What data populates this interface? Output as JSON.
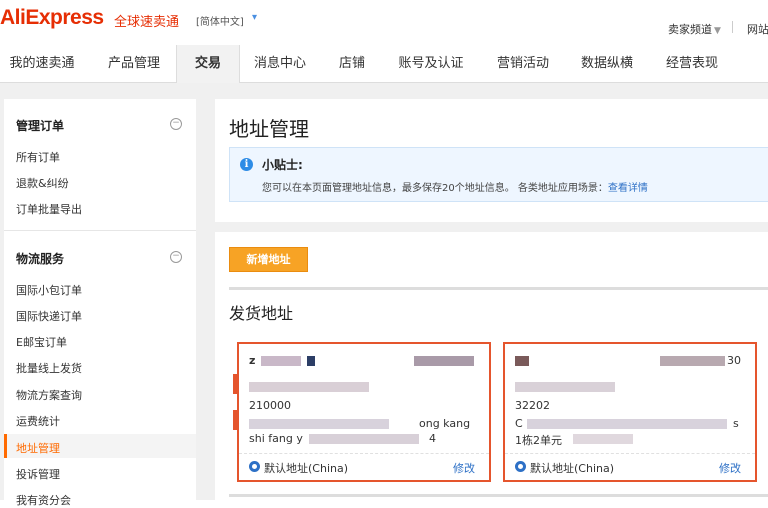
{
  "header": {
    "logo": "AliExpress",
    "logo_sub": "全球速卖通",
    "language": "[简体中文]",
    "seller_channel": "卖家频道",
    "site_link": "网站"
  },
  "nav": {
    "tabs": [
      {
        "label": "我的速卖通"
      },
      {
        "label": "产品管理"
      },
      {
        "label": "交易",
        "active": true
      },
      {
        "label": "消息中心"
      },
      {
        "label": "店铺"
      },
      {
        "label": "账号及认证"
      },
      {
        "label": "营销活动"
      },
      {
        "label": "数据纵横"
      },
      {
        "label": "经营表现"
      }
    ]
  },
  "sidebar": {
    "groups": [
      {
        "title": "管理订单",
        "items": [
          "所有订单",
          "退款&纠纷",
          "订单批量导出"
        ]
      },
      {
        "title": "物流服务",
        "items": [
          "国际小包订单",
          "国际快递订单",
          "E邮宝订单",
          "批量线上发货",
          "物流方案查询",
          "运费统计",
          "地址管理",
          "投诉管理",
          "我有资分会"
        ]
      }
    ],
    "active_item": "地址管理"
  },
  "main": {
    "title": "地址管理",
    "tip": {
      "title": "小贴士:",
      "text": "您可以在本页面管理地址信息，最多保存20个地址信息。 各类地址应用场景：",
      "link": "查看详情"
    },
    "add_button": "新增地址",
    "section_title": "发货地址",
    "cards": [
      {
        "line1": "z",
        "line3": "210000",
        "line4_tail": "ong kang",
        "line5_head": "shi fang y",
        "line5_tail": "4",
        "default_label": "默认地址(China)",
        "edit": "修改"
      },
      {
        "line1_tail": "30",
        "line3": "32202",
        "line4_head": "C",
        "line4_tail": "s",
        "line5": "1栋2单元",
        "default_label": "默认地址(China)",
        "edit": "修改"
      }
    ]
  },
  "colors": {
    "brand": "#e62e04",
    "accent_orange": "#ff6a00",
    "button_orange": "#f7a325",
    "card_border": "#e5552d",
    "link_blue": "#2d70c6"
  }
}
